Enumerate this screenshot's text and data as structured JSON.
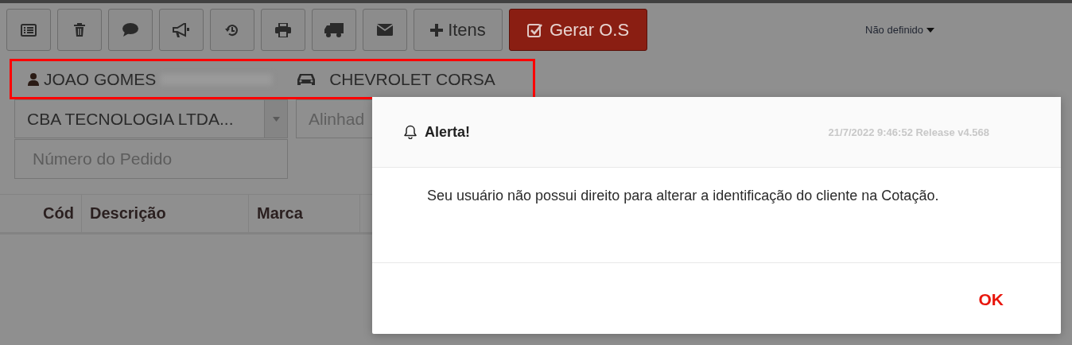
{
  "toolbar": {
    "buttons": [
      {
        "kind": "icon"
      },
      {
        "kind": "icon"
      },
      {
        "kind": "icon"
      },
      {
        "kind": "icon"
      },
      {
        "kind": "icon"
      },
      {
        "kind": "icon"
      },
      {
        "kind": "icon"
      },
      {
        "kind": "icon"
      },
      {
        "kind": "text",
        "label": "Itens"
      },
      {
        "kind": "primary",
        "label": "Gerar O.S"
      }
    ],
    "status_dropdown": "Não definido"
  },
  "identity": {
    "client": "JOAO GOMES",
    "vehicle": "CHEVROLET CORSA"
  },
  "form": {
    "company_select": "CBA TECNOLOGIA LTDA...",
    "service_field": "Alinhad",
    "order_number": {
      "placeholder": "Número do Pedido"
    }
  },
  "table": {
    "columns": [
      "Cód",
      "Descrição",
      "Marca"
    ]
  },
  "dialog": {
    "title": "Alerta!",
    "meta": "21/7/2022 9:46:52 Release v4.568",
    "message": "Seu usuário não possui direito para alterar a identificação do cliente na Cotação.",
    "buttons": [
      "OK"
    ]
  }
}
